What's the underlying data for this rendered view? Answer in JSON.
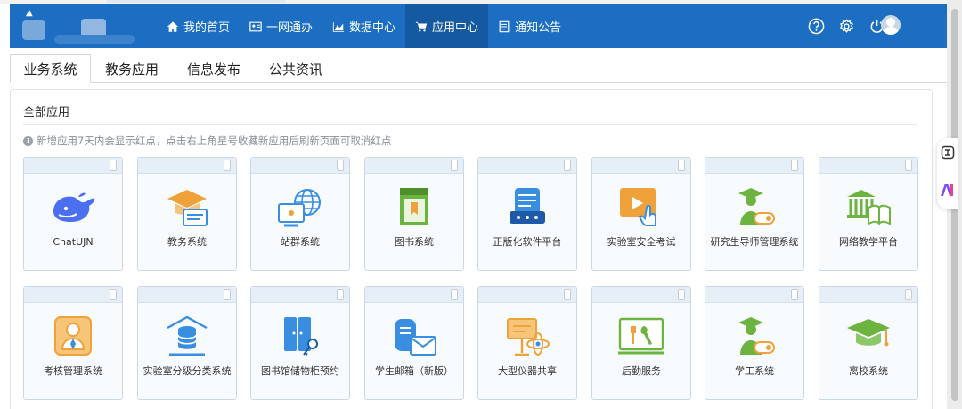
{
  "nav": {
    "items": [
      {
        "label": "我的首页",
        "icon": "home-icon"
      },
      {
        "label": "一网通办",
        "icon": "id-card-icon"
      },
      {
        "label": "数据中心",
        "icon": "area-chart-icon"
      },
      {
        "label": "应用中心",
        "icon": "cart-icon",
        "active": true
      },
      {
        "label": "通知公告",
        "icon": "notice-icon"
      }
    ],
    "tools": [
      "help-icon",
      "settings-icon",
      "power-icon",
      "avatar"
    ]
  },
  "tabs": [
    {
      "label": "业务系统",
      "active": true
    },
    {
      "label": "教务应用"
    },
    {
      "label": "信息发布"
    },
    {
      "label": "公共资讯"
    }
  ],
  "panel": {
    "title": "全部应用",
    "note": "新增应用7天内会显示红点，点击右上角星号收藏新应用后刷新页面可取消红点"
  },
  "apps": [
    {
      "label": "ChatUJN",
      "icon": "whale-icon"
    },
    {
      "label": "教务系统",
      "icon": "graduation-cap-icon"
    },
    {
      "label": "站群系统",
      "icon": "web-globe-icon"
    },
    {
      "label": "图书系统",
      "icon": "book-icon"
    },
    {
      "label": "正版化软件平台",
      "icon": "software-server-icon"
    },
    {
      "label": "实验室安全考试",
      "icon": "lab-exam-icon"
    },
    {
      "label": "研究生导师管理系统",
      "icon": "graduate-mentor-icon"
    },
    {
      "label": "网络教学平台",
      "icon": "online-teaching-icon"
    },
    {
      "label": "考核管理系统",
      "icon": "assessment-icon"
    },
    {
      "label": "实验室分级分类系统",
      "icon": "database-classify-icon"
    },
    {
      "label": "图书馆储物柜预约",
      "icon": "locker-icon"
    },
    {
      "label": "学生邮箱（新版）",
      "icon": "student-mail-icon"
    },
    {
      "label": "大型仪器共享",
      "icon": "instrument-share-icon"
    },
    {
      "label": "后勤服务",
      "icon": "logistics-tools-icon"
    },
    {
      "label": "学工系统",
      "icon": "student-affairs-icon"
    },
    {
      "label": "离校系统",
      "icon": "leave-school-icon"
    }
  ],
  "colors": {
    "nav_bg": "#1b6ec2",
    "nav_active": "#1559a0",
    "card_bg": "#f7fbfe",
    "icon_blue": "#3a8ee0",
    "icon_orange": "#f0a23a",
    "icon_green": "#6db33f"
  }
}
